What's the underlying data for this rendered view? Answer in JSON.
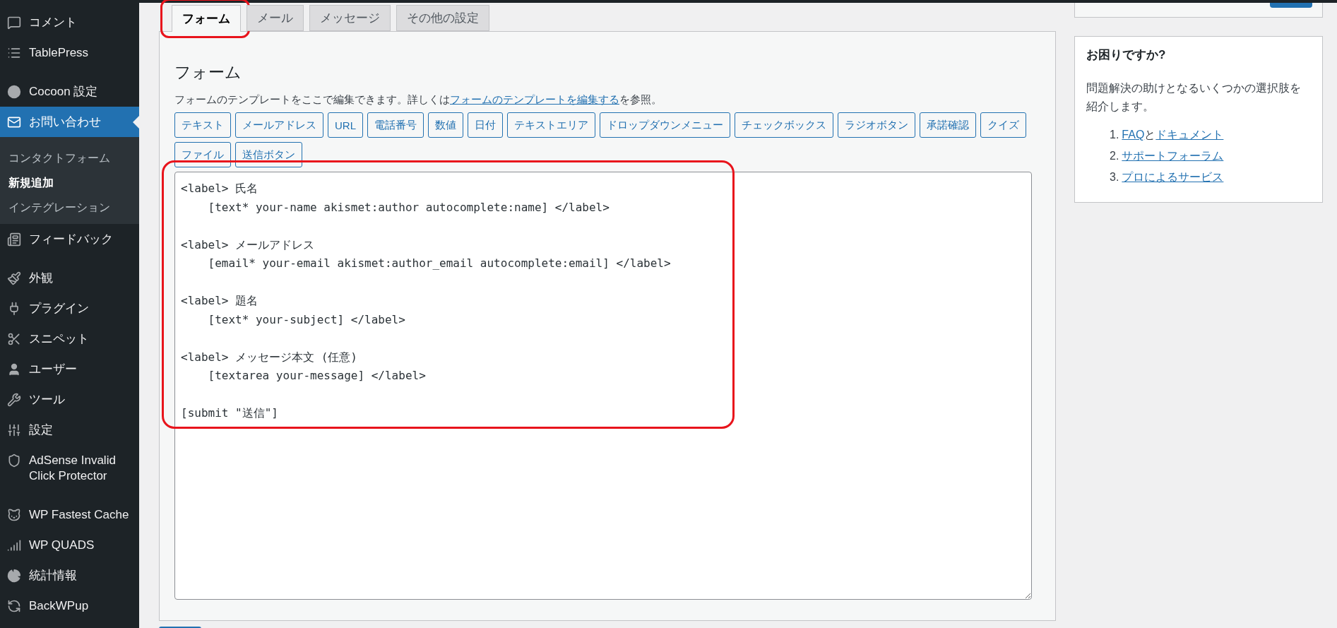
{
  "sidebar": {
    "groups": [
      [
        {
          "label": "コメント",
          "selected": false
        },
        {
          "label": "TablePress",
          "selected": false
        }
      ],
      [
        {
          "label": "Cocoon 設定",
          "selected": false
        },
        {
          "label": "お問い合わせ",
          "selected": true,
          "children": [
            {
              "label": "コンタクトフォーム",
              "selected": false
            },
            {
              "label": "新規追加",
              "selected": true
            },
            {
              "label": "インテグレーション",
              "selected": false
            }
          ]
        },
        {
          "label": "フィードバック",
          "selected": false
        }
      ],
      [
        {
          "label": "外観",
          "selected": false
        },
        {
          "label": "プラグイン",
          "selected": false
        },
        {
          "label": "スニペット",
          "selected": false
        },
        {
          "label": "ユーザー",
          "selected": false
        },
        {
          "label": "ツール",
          "selected": false
        },
        {
          "label": "設定",
          "selected": false
        },
        {
          "label": "AdSense Invalid Click Protector",
          "selected": false
        }
      ],
      [
        {
          "label": "WP Fastest Cache",
          "selected": false
        },
        {
          "label": "WP QUADS",
          "selected": false
        },
        {
          "label": "統計情報",
          "selected": false
        },
        {
          "label": "BackWPup",
          "selected": false
        }
      ]
    ]
  },
  "tabs": [
    {
      "label": "フォーム",
      "selected": true
    },
    {
      "label": "メール",
      "selected": false
    },
    {
      "label": "メッセージ",
      "selected": false
    },
    {
      "label": "その他の設定",
      "selected": false
    }
  ],
  "panel": {
    "heading": "フォーム",
    "description": [
      {
        "text": "フォームのテンプレートをここで編集できます。詳しくは",
        "link": false
      },
      {
        "text": "フォームのテンプレートを編集する",
        "link": true
      },
      {
        "text": "を参照。",
        "link": false
      }
    ],
    "tag_buttons": [
      "テキスト",
      "メールアドレス",
      "URL",
      "電話番号",
      "数値",
      "日付",
      "テキストエリア",
      "ドロップダウンメニュー",
      "チェックボックス",
      "ラジオボタン",
      "承諾確認",
      "クイズ",
      "ファイル",
      "送信ボタン"
    ],
    "editor": {
      "value": "<label> 氏名\n    [text* your-name akismet:author autocomplete:name] </label>\n\n<label> メールアドレス\n    [email* your-email akismet:author_email autocomplete:email] </label>\n\n<label> 題名\n    [text* your-subject] </label>\n\n<label> メッセージ本文 (任意)\n    [textarea your-message] </label>\n\n[submit \"送信\"]"
    }
  },
  "help": {
    "title": "お困りですか?",
    "body": "問題解決の助けとなるいくつかの選択肢を紹介します。",
    "items": [
      {
        "number": "1.",
        "parts": [
          {
            "text": "FAQ",
            "link": true
          },
          {
            "text": "と",
            "link": false
          },
          {
            "text": "ドキュメント",
            "link": true
          }
        ]
      },
      {
        "number": "2.",
        "parts": [
          {
            "text": "サポートフォーラム",
            "link": true
          }
        ]
      },
      {
        "number": "3.",
        "parts": [
          {
            "text": "プロによるサービス",
            "link": true
          }
        ]
      }
    ]
  }
}
